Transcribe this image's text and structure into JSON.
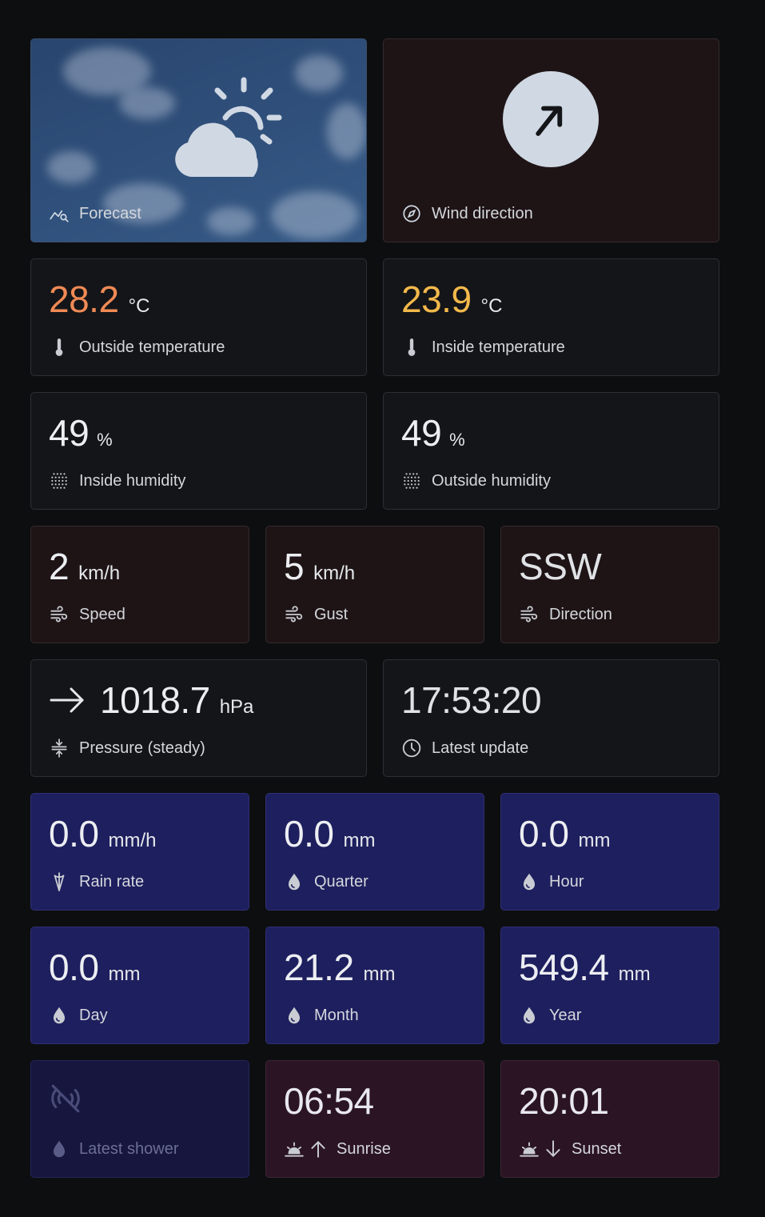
{
  "forecast": {
    "label": "Forecast",
    "icon": "partly-cloudy-icon"
  },
  "wind_dir_card": {
    "label": "Wind direction",
    "icon": "compass-icon"
  },
  "outside_temp": {
    "value": "28.2",
    "unit": "°C",
    "label": "Outside temperature",
    "color": "#f08a55"
  },
  "inside_temp": {
    "value": "23.9",
    "unit": "°C",
    "label": "Inside temperature",
    "color": "#f3b94b"
  },
  "inside_humidity": {
    "value": "49",
    "unit": "%",
    "label": "Inside humidity"
  },
  "outside_humidity": {
    "value": "49",
    "unit": "%",
    "label": "Outside humidity"
  },
  "wind_speed": {
    "value": "2",
    "unit": "km/h",
    "label": "Speed"
  },
  "wind_gust": {
    "value": "5",
    "unit": "km/h",
    "label": "Gust"
  },
  "wind_direction": {
    "value": "SSW",
    "label": "Direction"
  },
  "pressure": {
    "value": "1018.7",
    "unit": "hPa",
    "label": "Pressure (steady)",
    "trend_icon": "arrow-right-icon"
  },
  "latest_update": {
    "value": "17:53:20",
    "label": "Latest update"
  },
  "rain_rate": {
    "value": "0.0",
    "unit": "mm/h",
    "label": "Rain rate"
  },
  "rain_quarter": {
    "value": "0.0",
    "unit": "mm",
    "label": "Quarter"
  },
  "rain_hour": {
    "value": "0.0",
    "unit": "mm",
    "label": "Hour"
  },
  "rain_day": {
    "value": "0.0",
    "unit": "mm",
    "label": "Day"
  },
  "rain_month": {
    "value": "21.2",
    "unit": "mm",
    "label": "Month"
  },
  "rain_year": {
    "value": "549.4",
    "unit": "mm",
    "label": "Year"
  },
  "latest_shower": {
    "label": "Latest shower",
    "icon": "no-signal-icon"
  },
  "sunrise": {
    "value": "06:54",
    "label": "Sunrise"
  },
  "sunset": {
    "value": "20:01",
    "label": "Sunset"
  },
  "colors": {
    "background": "#0d0e10",
    "card": "#141518",
    "wind_card": "#1e1416",
    "rain_card": "#1e1f5e",
    "sun_card": "#2b1424"
  }
}
